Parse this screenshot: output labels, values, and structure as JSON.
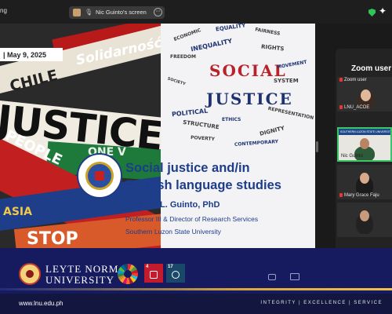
{
  "topbar": {
    "app_label": "ng",
    "share_label": "Nic Guinto's screen",
    "share_more_symbol": "⋯",
    "sparkle_symbol": "✦"
  },
  "slide": {
    "date": "| May 9, 2025",
    "collage_words": [
      "CHILE",
      "Solidarność",
      "JUSTICE",
      "PEOPLE",
      "ONE V",
      "ASIA",
      "STOP"
    ],
    "cloud_title_1": "SOCIAL",
    "cloud_title_2": "JUSTICE",
    "cloud_words": [
      "EQUALITY",
      "ECONOMIC",
      "FAIRNESS",
      "INEQUALITY",
      "RIGHTS",
      "FREEDOM",
      "MOVEMENT",
      "SOCIETY",
      "SYSTEM",
      "POLITICAL",
      "REPRESENTATION",
      "STRUCTURE",
      "ETHICS",
      "DIGNITY",
      "POVERTY",
      "CONTEMPORARY"
    ],
    "title_line1": "Social justice and/in",
    "title_line2": "English language studies",
    "author": "Nicanor L. Guinto, PhD",
    "role": "Professor III & Director of Research Services",
    "institution": "Southern Luzon State University"
  },
  "panel": {
    "title": "Zoom user",
    "participants": [
      {
        "name": "Zoom user",
        "muted": true
      },
      {
        "name": "LNU_ACOE",
        "muted": true
      },
      {
        "name": "Nic Guinto",
        "muted": false,
        "active_speaker": true
      },
      {
        "name": "Mary Grace Faju",
        "muted": true
      },
      {
        "name": "",
        "muted": true
      }
    ],
    "active_tile_banner": "SOUTHERN LUZON STATE UNIVERSITY"
  },
  "band": {
    "university_line1": "LEYTE NORMAL",
    "university_line2": "UNIVERSITY",
    "sdg4_label": "4",
    "sdg17_label": "17"
  },
  "footer": {
    "url": "www.lnu.edu.ph",
    "motto": "INTEGRITY | EXCELLENCE | SERVICE"
  },
  "colors": {
    "title_blue": "#1d3d8a",
    "band_navy": "#161a5e",
    "gold": "#f0c14b",
    "speaker_green": "#3cc46a",
    "cloud_red": "#b8222a",
    "cloud_navy": "#1e3270"
  }
}
